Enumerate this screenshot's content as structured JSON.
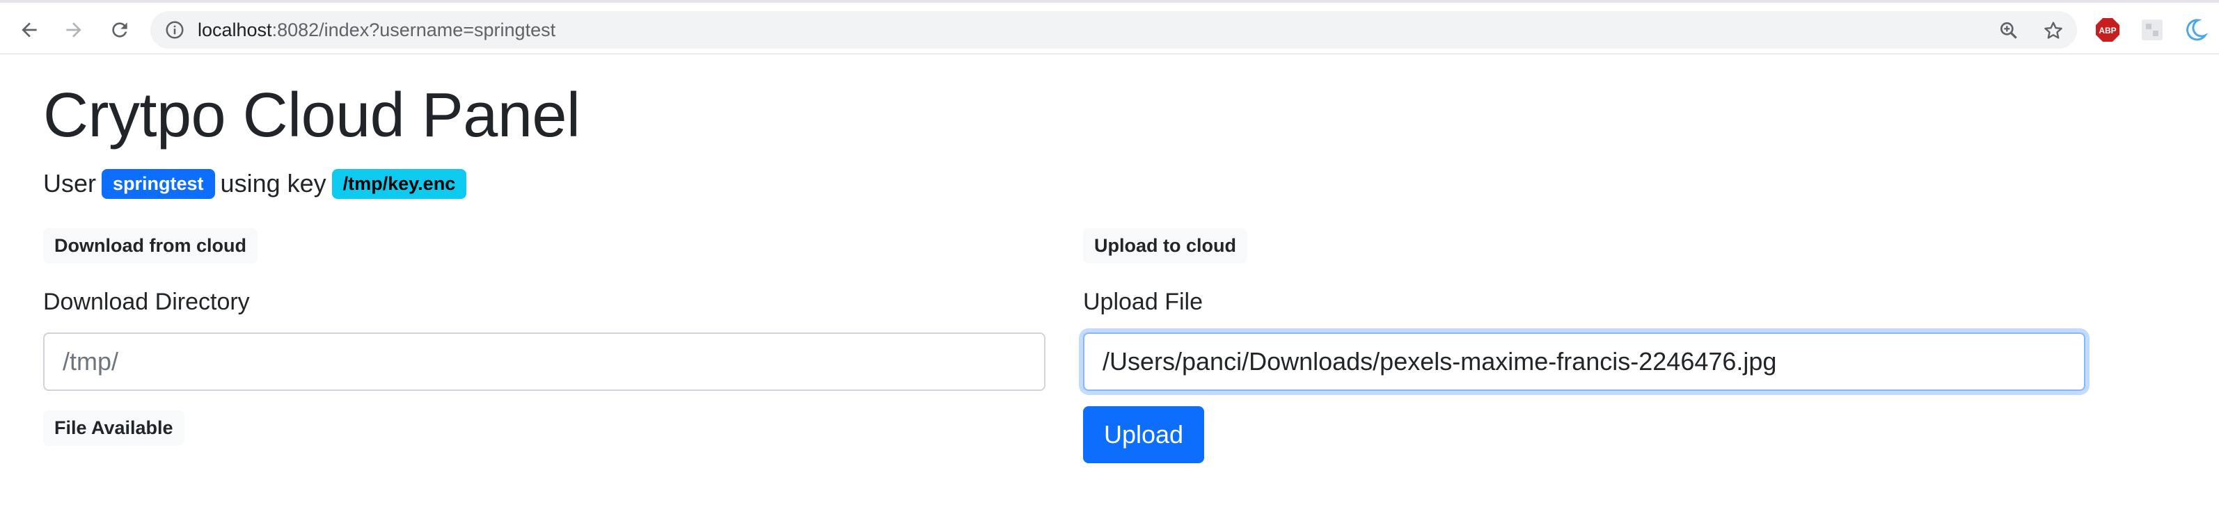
{
  "browser": {
    "url_host": "localhost",
    "url_rest": ":8082/index?username=springtest",
    "icons": [
      "back-arrow-icon",
      "forward-arrow-icon",
      "reload-icon",
      "info-icon",
      "zoom-icon",
      "star-icon",
      "adblock-icon",
      "extension-icon",
      "extension-moon-icon"
    ],
    "adblock_label": "ABP"
  },
  "page": {
    "title": "Crytpo Cloud Panel",
    "user_prefix": "User",
    "username": "springtest",
    "key_prefix": "using key",
    "key_path": "/tmp/key.enc"
  },
  "download": {
    "section_label": "Download from cloud",
    "directory_label": "Download Directory",
    "directory_placeholder": "/tmp/",
    "files_label": "File Available"
  },
  "upload": {
    "section_label": "Upload to cloud",
    "file_label": "Upload File",
    "file_value": "/Users/panci/Downloads/pexels-maxime-francis-2246476.jpg",
    "button_label": "Upload"
  },
  "colors": {
    "primary": "#0d6efd",
    "info": "#0dcaf0",
    "focus_border": "#86b7fe",
    "adblock_red": "#c71e20"
  }
}
